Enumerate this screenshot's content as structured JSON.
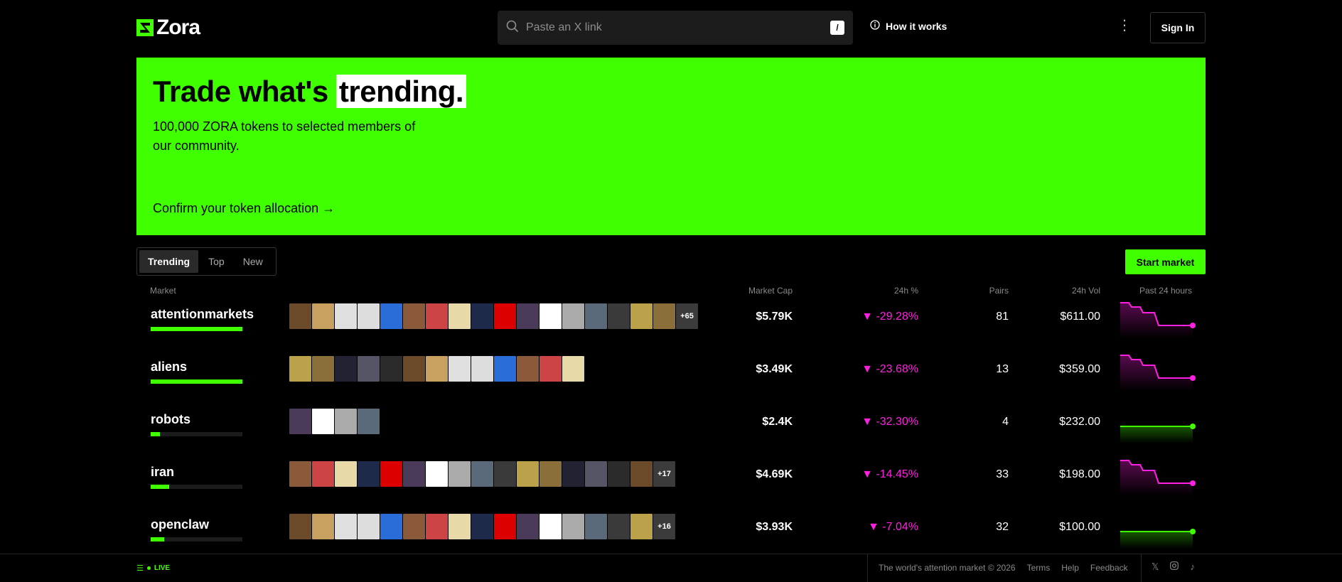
{
  "header": {
    "logo_text": "Zora",
    "search_placeholder": "Paste an X link",
    "search_shortcut": "/",
    "how_it_works": "How it works",
    "sign_in": "Sign In"
  },
  "hero": {
    "title_plain": "Trade what's ",
    "title_highlight": "trending.",
    "subtitle": "100,000 ZORA tokens to selected members of our community.",
    "cta": "Confirm your token allocation →",
    "color": "#40ff00"
  },
  "tabs": [
    "Trending",
    "Top",
    "New"
  ],
  "active_tab": "Trending",
  "start_market": "Start market",
  "columns": {
    "market": "Market",
    "market_cap": "Market Cap",
    "change": "24h %",
    "pairs": "Pairs",
    "volume": "24h Vol",
    "chart": "Past 24 hours"
  },
  "rows": [
    {
      "name": "attentionmarkets",
      "progress": 1.0,
      "thumbs": 17,
      "more": "+65",
      "market_cap": "$5.79K",
      "change": "▼ -29.28%",
      "pairs": "81",
      "volume": "$611.00",
      "trend": "down"
    },
    {
      "name": "aliens",
      "progress": 1.0,
      "thumbs": 13,
      "more": "",
      "market_cap": "$3.49K",
      "change": "▼ -23.68%",
      "pairs": "13",
      "volume": "$359.00",
      "trend": "down"
    },
    {
      "name": "robots",
      "progress": 0.1,
      "thumbs": 4,
      "more": "",
      "market_cap": "$2.4K",
      "change": "▼ -32.30%",
      "pairs": "4",
      "volume": "$232.00",
      "trend": "flat"
    },
    {
      "name": "iran",
      "progress": 0.2,
      "thumbs": 16,
      "more": "+17",
      "market_cap": "$4.69K",
      "change": "▼ -14.45%",
      "pairs": "33",
      "volume": "$198.00",
      "trend": "down"
    },
    {
      "name": "openclaw",
      "progress": 0.15,
      "thumbs": 16,
      "more": "+16",
      "market_cap": "$3.93K",
      "change": "▼ -7.04%",
      "pairs": "32",
      "volume": "$100.00",
      "trend": "flat"
    }
  ],
  "footer": {
    "live": "LIVE",
    "tagline": "The world's attention market © 2026",
    "links": [
      "Terms",
      "Help",
      "Feedback"
    ],
    "social": [
      "x-icon",
      "instagram-icon",
      "tiktok-icon"
    ]
  },
  "colors": {
    "accent": "#40ff00",
    "negative": "#ff1fe1"
  }
}
